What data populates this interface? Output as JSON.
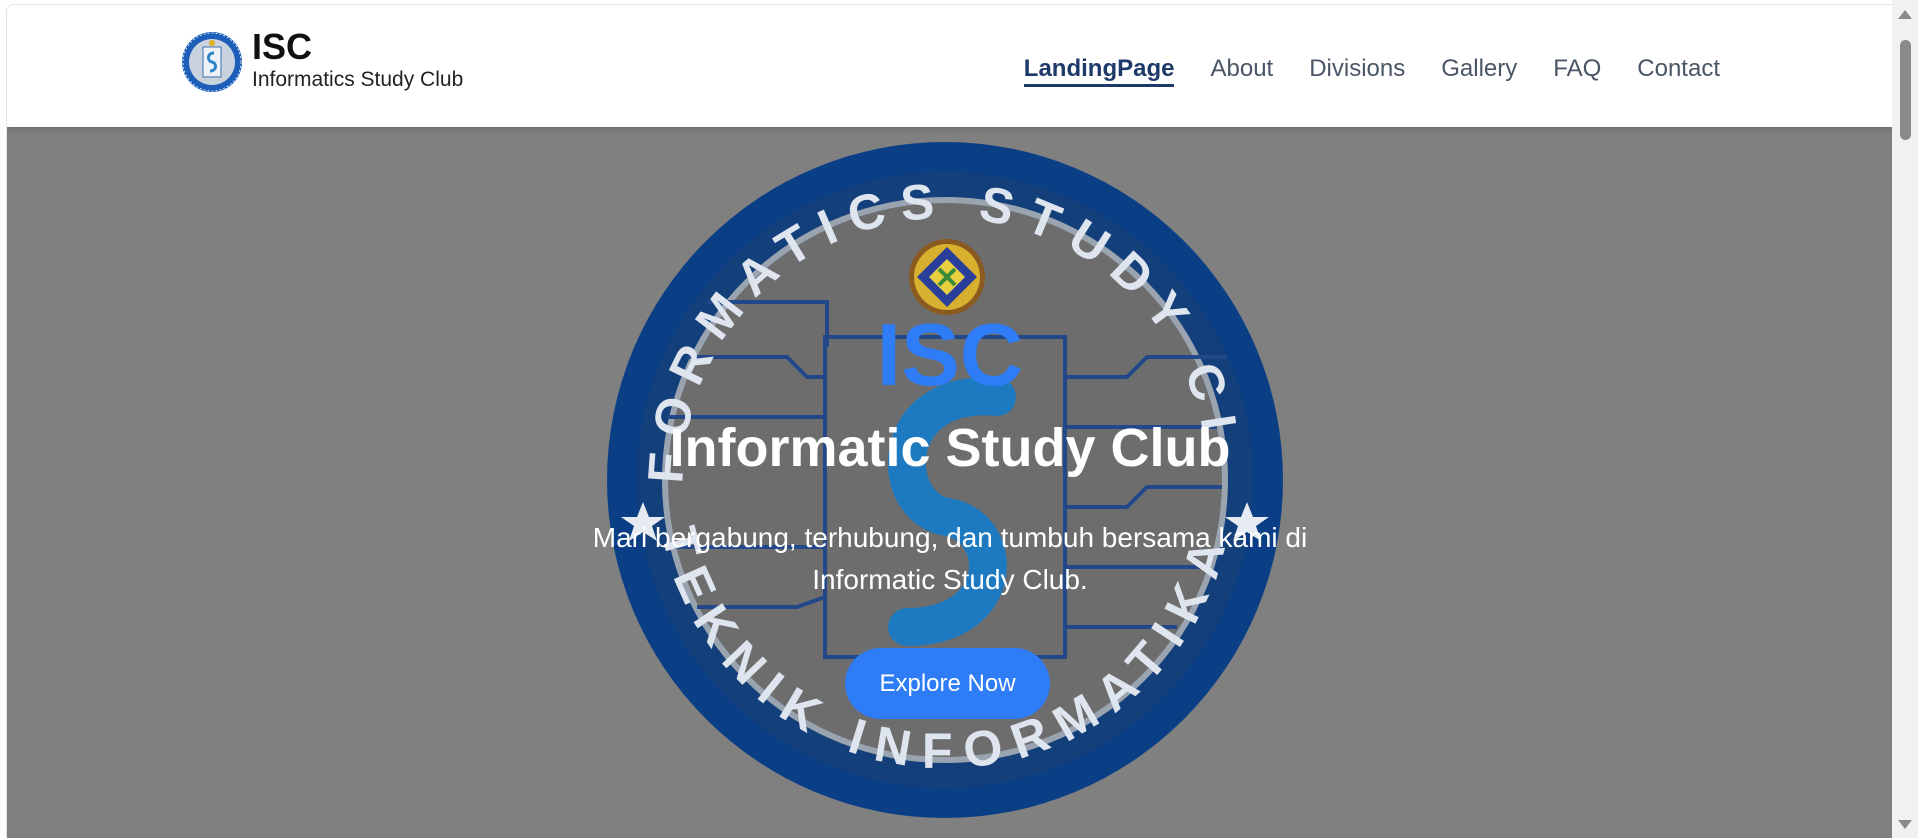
{
  "brand": {
    "title": "ISC",
    "subtitle": "Informatics Study Club",
    "logo_icon": "isc-logo-icon"
  },
  "nav": {
    "items": [
      {
        "label": "LandingPage",
        "active": true
      },
      {
        "label": "About",
        "active": false
      },
      {
        "label": "Divisions",
        "active": false
      },
      {
        "label": "Gallery",
        "active": false
      },
      {
        "label": "FAQ",
        "active": false
      },
      {
        "label": "Contact",
        "active": false
      }
    ]
  },
  "hero": {
    "background_logo_text_top": "INFORMATICS STUDY CLUB",
    "background_logo_text_bottom": "TEKNIK INFORMATIKA",
    "acronym": "ISC",
    "title": "Informatic Study Club",
    "description": "Mari bergabung, terhubung, dan tumbuh bersama kami di Informatic Study Club.",
    "button_label": "Explore Now"
  },
  "colors": {
    "accent": "#2e7cf6",
    "nav_active": "#1e3a6a",
    "nav_text": "#4a5566",
    "hero_bg": "#808080",
    "logo_ring": "#0c4aa0"
  }
}
